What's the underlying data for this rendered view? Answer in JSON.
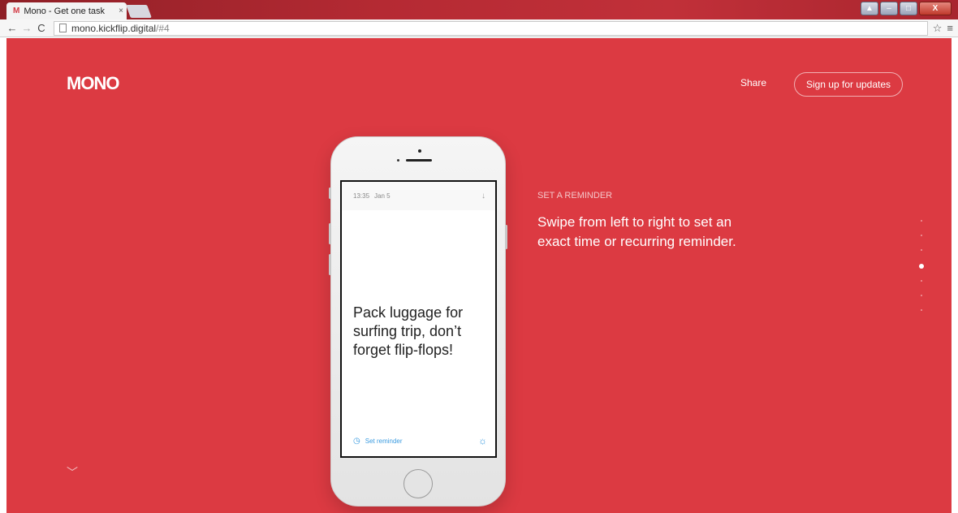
{
  "browser": {
    "tab_favicon": "M",
    "tab_title": "Mono - Get one task",
    "tab_close": "×",
    "url_host": "mono.kickflip.digital",
    "url_path": "/#4"
  },
  "header": {
    "logo": "MONO",
    "share": "Share",
    "signup": "Sign up for updates"
  },
  "feature": {
    "eyebrow": "SET A REMINDER",
    "headline": "Swipe from left to right to set an exact time or recurring reminder."
  },
  "pager": {
    "total": 7,
    "active_index": 3
  },
  "phone": {
    "time": "13:35",
    "date": "Jan 5",
    "task": "Pack luggage for surfing trip, don’t forget flip-flops!",
    "set_reminder": "Set reminder"
  },
  "colors": {
    "brand": "#dc3a42",
    "accent": "#3a9be0"
  },
  "icons": [
    "back-icon",
    "forward-icon",
    "reload-icon",
    "star-icon",
    "menu-icon",
    "chevron-down-icon",
    "clock-icon",
    "sun-icon",
    "arrow-down-icon"
  ]
}
